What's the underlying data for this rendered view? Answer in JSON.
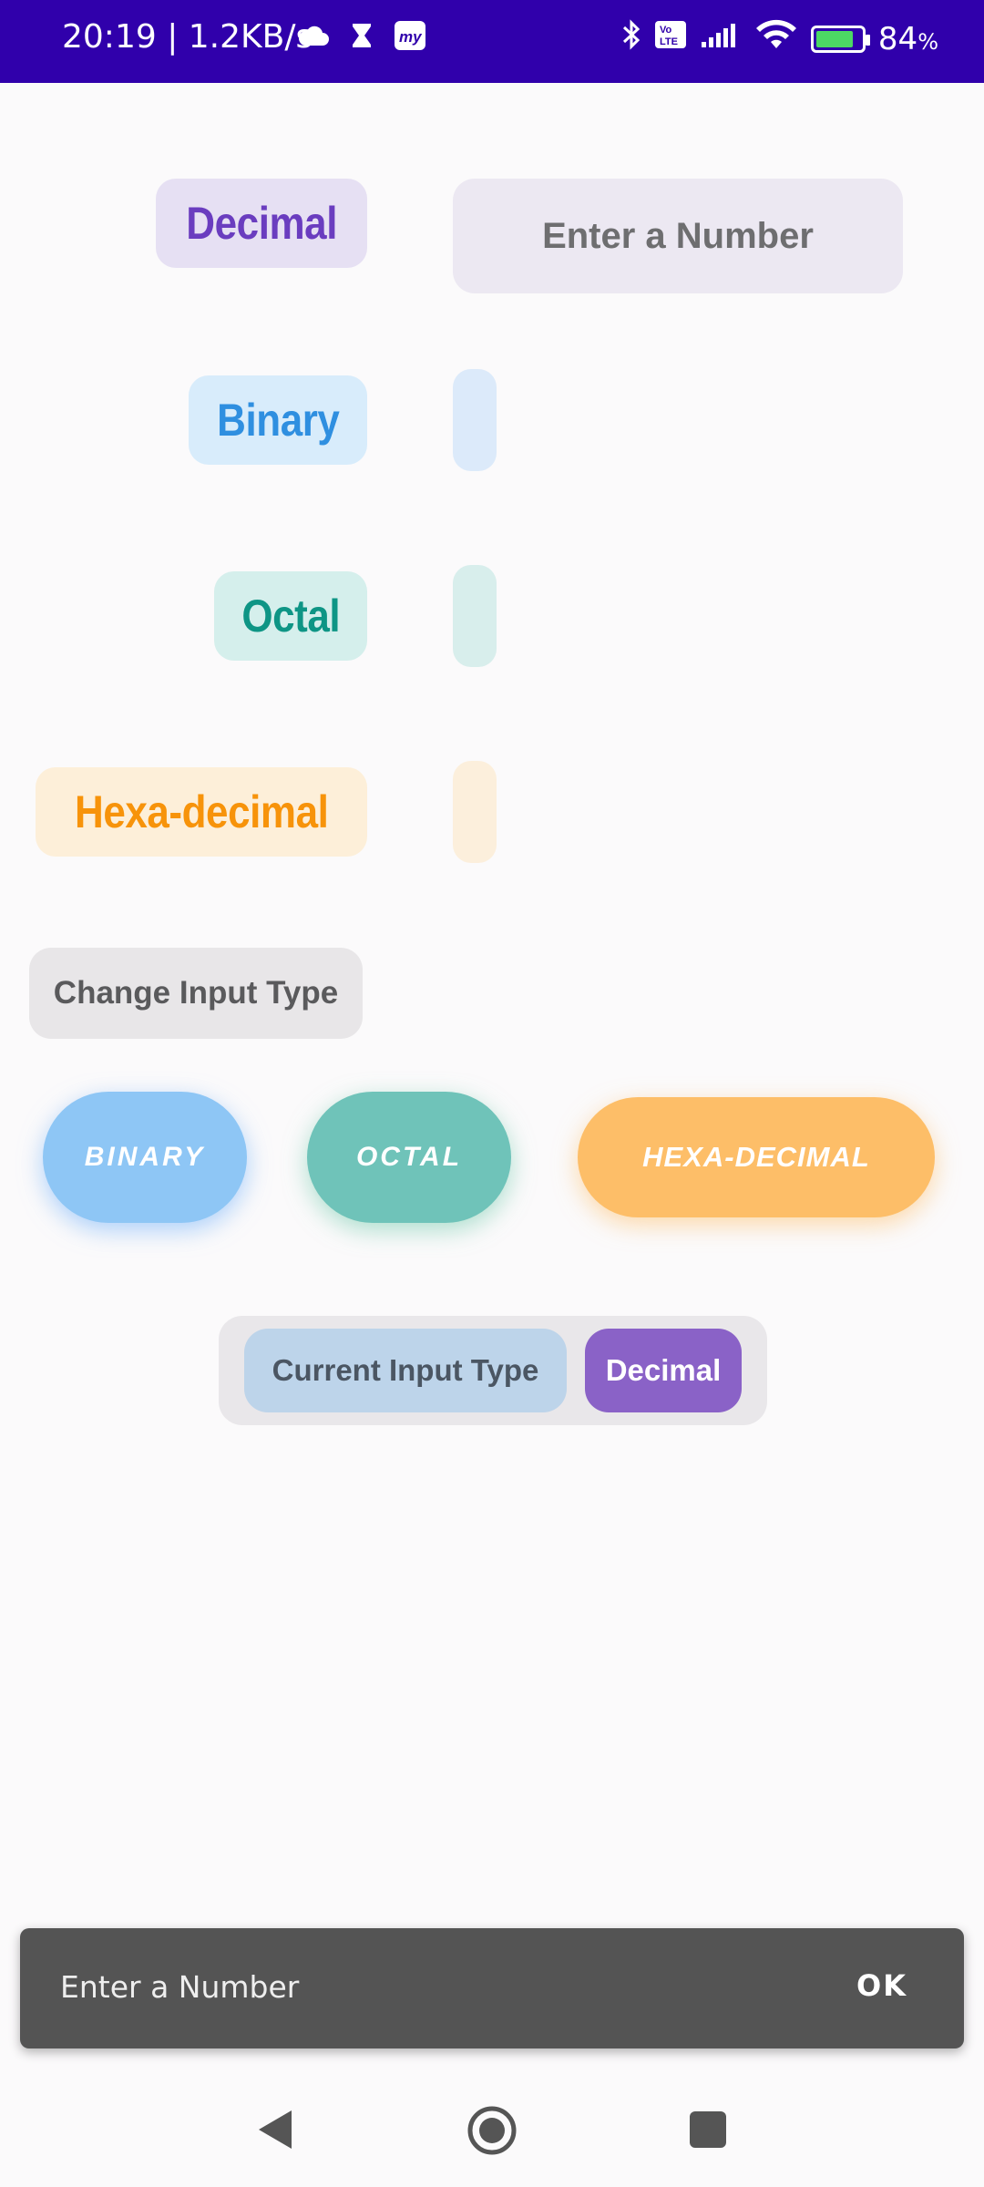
{
  "status_bar": {
    "time_speed": "20:19 | 1.2KB/s",
    "network_badge": "Vo LTE",
    "battery_percent": "84",
    "battery_suffix": "%",
    "battery_level": 0.84,
    "icons": [
      "cloud-icon",
      "hourglass-icon",
      "myapp-icon",
      "bluetooth-icon",
      "volte-icon",
      "signal-icon",
      "wifi-icon",
      "battery-icon"
    ]
  },
  "converter": {
    "decimal_label": "Decimal",
    "binary_label": "Binary",
    "octal_label": "Octal",
    "hex_label": "Hexa-decimal",
    "input_placeholder": "Enter a Number",
    "binary_output": "",
    "octal_output": "",
    "hex_output": ""
  },
  "change_input_type_label": "Change Input Type",
  "type_buttons": {
    "binary": "BINARY",
    "octal": "OCTAL",
    "hex": "HEXA-DECIMAL"
  },
  "current": {
    "label": "Current Input Type",
    "value": "Decimal"
  },
  "snackbar": {
    "message": "Enter a Number",
    "action": "OK"
  },
  "colors": {
    "status_bar": "#3000ab",
    "decimal": "#6a3dbf",
    "binary": "#2f8fe0",
    "octal": "#0e9585",
    "hex": "#f7930a"
  }
}
